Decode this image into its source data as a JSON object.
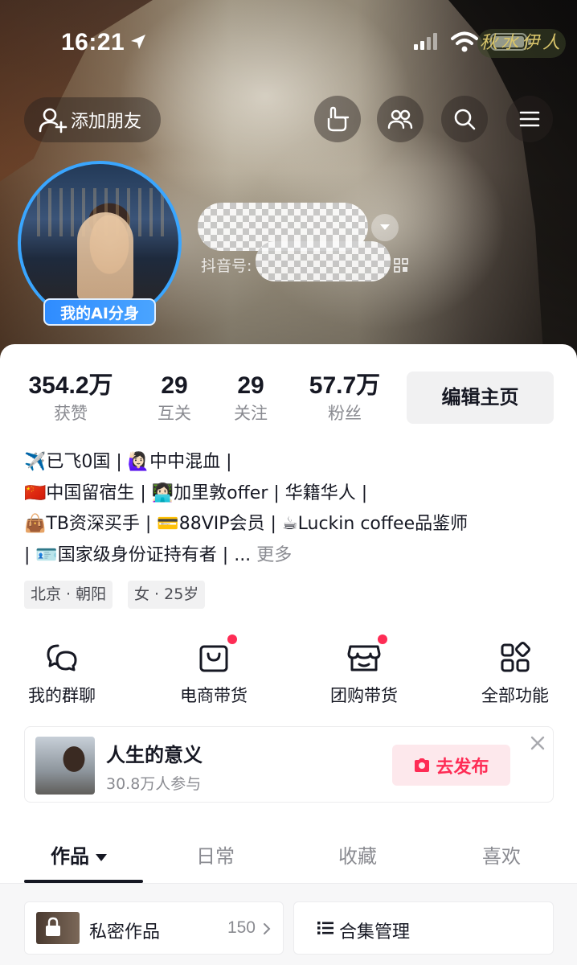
{
  "status_bar": {
    "time": "16:21",
    "watermark": "秋水伊人"
  },
  "header": {
    "add_friend_label": "添加朋友",
    "icons": [
      "hand-point-icon",
      "friends-icon",
      "search-icon",
      "menu-icon"
    ]
  },
  "profile": {
    "ai_badge": "我的AI分身",
    "douyin_id_label": "抖音号:"
  },
  "stats": [
    {
      "value": "354.2万",
      "label": "获赞"
    },
    {
      "value": "29",
      "label": "互关"
    },
    {
      "value": "29",
      "label": "关注"
    },
    {
      "value": "57.7万",
      "label": "粉丝"
    }
  ],
  "edit_profile_label": "编辑主页",
  "bio": {
    "line1": "✈️已飞0国 | 🙋🏻‍♀️中中混血 |",
    "line2": "🇨🇳中国留宿生 | 👩🏻‍💻加里敦offer | 华籍华人  |",
    "line3": "👜TB资深买手 | 💳88VIP会员 | ☕Luckin coffee品鉴师",
    "line4": " | 🪪国家级身份证持有者 | ...",
    "more": "更多"
  },
  "tags": [
    "北京 · 朝阳",
    "女 · 25岁"
  ],
  "shortcuts": [
    {
      "label": "我的群聊",
      "icon": "group-chat-icon",
      "dot": false
    },
    {
      "label": "电商带货",
      "icon": "shopping-bag-icon",
      "dot": true
    },
    {
      "label": "团购带货",
      "icon": "store-icon",
      "dot": true
    },
    {
      "label": "全部功能",
      "icon": "all-features-icon",
      "dot": false
    }
  ],
  "topic_card": {
    "title": "人生的意义",
    "subtitle": "30.8万人参与",
    "publish_label": "去发布"
  },
  "tabs": [
    {
      "label": "作品",
      "active": true
    },
    {
      "label": "日常",
      "active": false
    },
    {
      "label": "收藏",
      "active": false
    },
    {
      "label": "喜欢",
      "active": false
    }
  ],
  "private_works": {
    "label": "私密作品",
    "count": "150"
  },
  "collection_manage": {
    "label": "合集管理"
  },
  "colors": {
    "accent": "#fe2c55",
    "ai_badge": "#3aa6ff",
    "text": "#161823",
    "muted": "#8a8b91"
  }
}
